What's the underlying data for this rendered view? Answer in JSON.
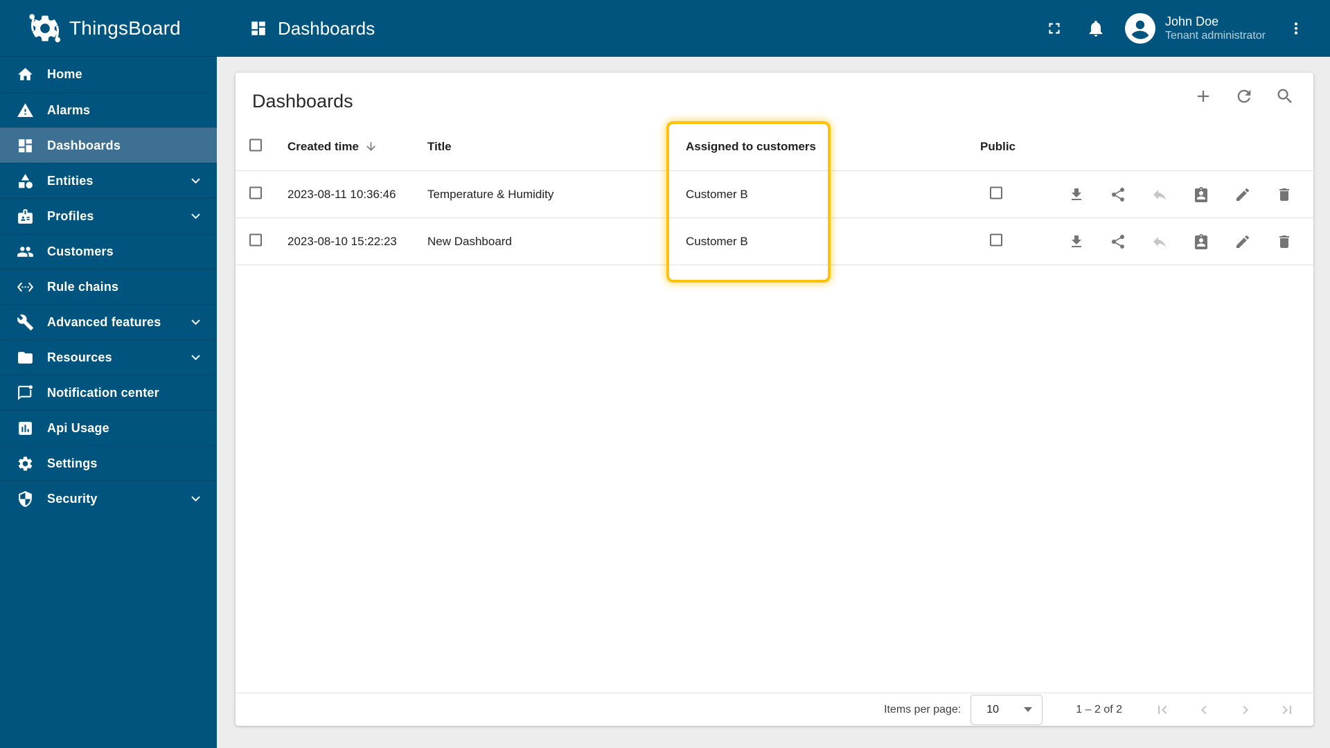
{
  "app": {
    "name": "ThingsBoard"
  },
  "topbar": {
    "title": "Dashboards",
    "icons": [
      "fullscreen-icon",
      "notifications-bell-icon",
      "more-vert-icon"
    ],
    "user": {
      "name": "John Doe",
      "role": "Tenant administrator"
    }
  },
  "sidebar": {
    "items": [
      {
        "label": "Home",
        "icon": "home",
        "selected": false,
        "expandable": false
      },
      {
        "label": "Alarms",
        "icon": "warning",
        "selected": false,
        "expandable": false
      },
      {
        "label": "Dashboards",
        "icon": "dashboard",
        "selected": true,
        "expandable": false
      },
      {
        "label": "Entities",
        "icon": "category",
        "selected": false,
        "expandable": true
      },
      {
        "label": "Profiles",
        "icon": "badge",
        "selected": false,
        "expandable": true
      },
      {
        "label": "Customers",
        "icon": "people",
        "selected": false,
        "expandable": false
      },
      {
        "label": "Rule chains",
        "icon": "settings-ethernet",
        "selected": false,
        "expandable": false
      },
      {
        "label": "Advanced features",
        "icon": "construction",
        "selected": false,
        "expandable": true
      },
      {
        "label": "Resources",
        "icon": "folder",
        "selected": false,
        "expandable": true
      },
      {
        "label": "Notification center",
        "icon": "chat-unread",
        "selected": false,
        "expandable": false
      },
      {
        "label": "Api Usage",
        "icon": "insert-chart",
        "selected": false,
        "expandable": false
      },
      {
        "label": "Settings",
        "icon": "settings",
        "selected": false,
        "expandable": false
      },
      {
        "label": "Security",
        "icon": "security",
        "selected": false,
        "expandable": true
      }
    ]
  },
  "page": {
    "title": "Dashboards",
    "toolbar": [
      {
        "name": "add-dashboard-button",
        "icon": "add"
      },
      {
        "name": "refresh-button",
        "icon": "refresh"
      },
      {
        "name": "search-button",
        "icon": "search"
      }
    ]
  },
  "table": {
    "columns": {
      "created": "Created time",
      "title": "Title",
      "assigned": "Assigned to customers",
      "public": "Public"
    },
    "sorted_by": "Created time descending",
    "rows": [
      {
        "created": "2023-08-11 10:36:46",
        "title": "Temperature & Humidity",
        "assigned": "Customer B",
        "public": false,
        "selected": false
      },
      {
        "created": "2023-08-10 15:22:23",
        "title": "New Dashboard",
        "assigned": "Customer B",
        "public": false,
        "selected": false
      }
    ],
    "row_actions": [
      {
        "name": "export-dashboard-button",
        "icon": "download",
        "disabled": false
      },
      {
        "name": "make-public-button",
        "icon": "share",
        "disabled": false
      },
      {
        "name": "unassign-from-customer-button",
        "icon": "reply",
        "disabled": true
      },
      {
        "name": "manage-assigned-customers-button",
        "icon": "assignment",
        "disabled": false
      },
      {
        "name": "edit-dashboard-button",
        "icon": "edit",
        "disabled": false
      },
      {
        "name": "delete-dashboard-button",
        "icon": "delete",
        "disabled": false
      }
    ]
  },
  "annotation": {
    "highlighted_column": "Assigned to customers",
    "highlight_color": "#FFC107"
  },
  "footer": {
    "items_per_page_label": "Items per page:",
    "items_per_page_value": "10",
    "range_label": "1 – 2 of 2",
    "pager_icons": [
      "first-page-icon",
      "chevron-left-icon",
      "chevron-right-icon",
      "last-page-icon"
    ]
  },
  "colors": {
    "nav_background": "#01547E",
    "nav_selected": "#3D7093",
    "accent_highlight": "#FFC107",
    "icon_gray": "#757575",
    "icon_disabled": "#c7c7c7",
    "content_background": "#ededed",
    "text_dark": "#212121"
  }
}
